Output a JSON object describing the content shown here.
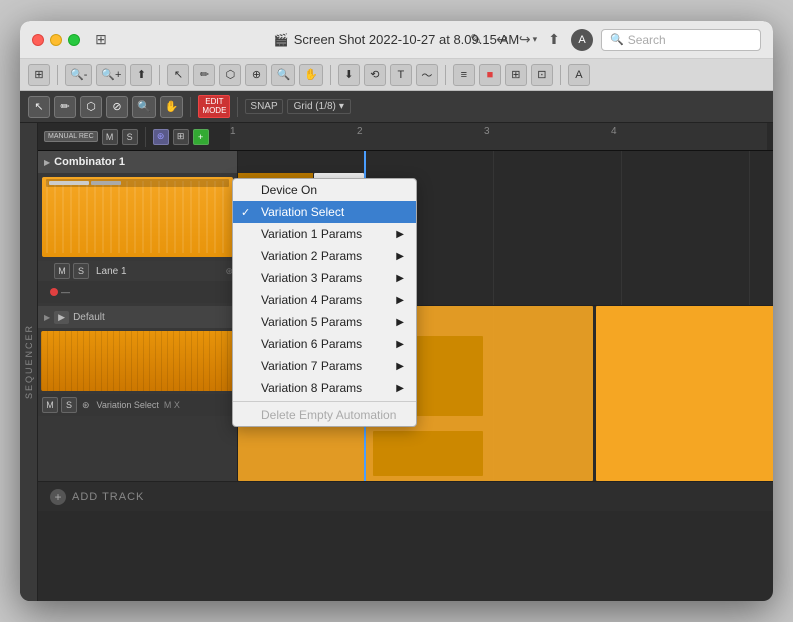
{
  "window": {
    "title": "Screen Shot 2022-10-27 at 8.09.15 AM"
  },
  "titlebar": {
    "title": "Screen Shot 2022-10-27 at 8.09.15 AM",
    "search_placeholder": "Search",
    "edit_icon": "✎",
    "undo_icon": "↩",
    "redo_icon": "↪",
    "share_icon": "⬆"
  },
  "toolbar1": {
    "items": [
      "⊞",
      "🔍",
      "-",
      "+",
      "⬆",
      "✂",
      "✏",
      "⬡",
      "⊕",
      "🔍",
      "✋"
    ]
  },
  "toolbar2": {
    "edit_mode": "EDIT\nMODE",
    "snap": "SNAP",
    "grid": "Grid (1/8)",
    "icons": [
      "→",
      "▦",
      "⊕",
      "≡",
      "⊞",
      "⊡",
      "A"
    ]
  },
  "track_controls": {
    "manual_rec": "MANUAL REC",
    "m": "M",
    "s": "S",
    "add_icon": "+",
    "grid_icon": "⊞"
  },
  "ruler": {
    "marks": [
      "1",
      "2",
      "3",
      "4"
    ]
  },
  "tracks": [
    {
      "id": "combinator",
      "name": "Combinator 1",
      "sub_track": {
        "name": "Lane 1",
        "m": "M",
        "s": "S"
      }
    },
    {
      "id": "default",
      "name": "Default",
      "lane_label": "Variation Select",
      "mx": "M X"
    }
  ],
  "dropdown": {
    "items": [
      {
        "label": "Device On",
        "selected": false,
        "has_arrow": false,
        "disabled": false,
        "checked": false
      },
      {
        "label": "Variation Select",
        "selected": true,
        "has_arrow": false,
        "disabled": false,
        "checked": true
      },
      {
        "label": "Variation 1 Params",
        "selected": false,
        "has_arrow": true,
        "disabled": false,
        "checked": false
      },
      {
        "label": "Variation 2 Params",
        "selected": false,
        "has_arrow": true,
        "disabled": false,
        "checked": false
      },
      {
        "label": "Variation 3 Params",
        "selected": false,
        "has_arrow": true,
        "disabled": false,
        "checked": false
      },
      {
        "label": "Variation 4 Params",
        "selected": false,
        "has_arrow": true,
        "disabled": false,
        "checked": false
      },
      {
        "label": "Variation 5 Params",
        "selected": false,
        "has_arrow": true,
        "disabled": false,
        "checked": false
      },
      {
        "label": "Variation 6 Params",
        "selected": false,
        "has_arrow": true,
        "disabled": false,
        "checked": false
      },
      {
        "label": "Variation 7 Params",
        "selected": false,
        "has_arrow": true,
        "disabled": false,
        "checked": false
      },
      {
        "label": "Variation 8 Params",
        "selected": false,
        "has_arrow": true,
        "disabled": false,
        "checked": false
      },
      {
        "label": "Delete Empty Automation",
        "selected": false,
        "has_arrow": false,
        "disabled": true,
        "checked": false
      }
    ]
  },
  "add_track": {
    "label": "ADD TRACK"
  },
  "colors": {
    "orange": "#f5a623",
    "dark_orange": "#cc8800",
    "blue_playhead": "#4a9eff",
    "menu_selected": "#3a7fcf"
  }
}
